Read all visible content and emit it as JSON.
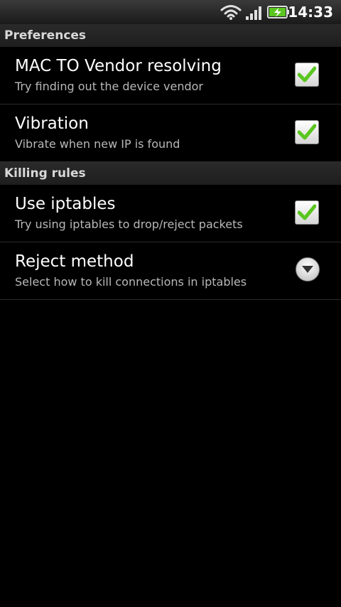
{
  "status_bar": {
    "time": "14:33",
    "icons": [
      "wifi-icon",
      "signal-icon",
      "battery-charging-icon"
    ],
    "accent_color": "#5ac61f"
  },
  "sections": [
    {
      "title": "Preferences",
      "items": [
        {
          "title": "MAC TO Vendor resolving",
          "summary": "Try finding out the device vendor",
          "control": "checkbox",
          "checked": true
        },
        {
          "title": "Vibration",
          "summary": "Vibrate when new IP is found",
          "control": "checkbox",
          "checked": true
        }
      ]
    },
    {
      "title": "Killing rules",
      "items": [
        {
          "title": "Use iptables",
          "summary": "Try using iptables to drop/reject packets",
          "control": "checkbox",
          "checked": true
        },
        {
          "title": "Reject method",
          "summary": "Select how to kill connections in iptables",
          "control": "dropdown",
          "icon": "chevron-down-icon"
        }
      ]
    }
  ],
  "colors": {
    "background": "#000000",
    "title_text": "#ffffff",
    "summary_text": "#b8b8b8",
    "check_green": "#5ac61f"
  }
}
